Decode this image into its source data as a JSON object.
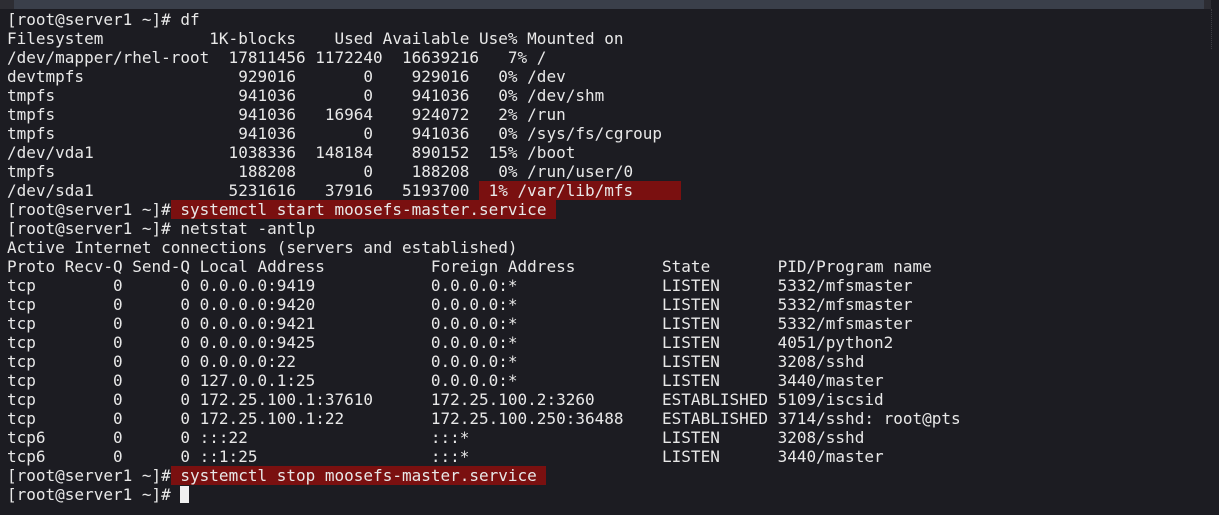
{
  "terminal": {
    "prompt": "[root@server1 ~]#",
    "lines": [
      {
        "t": "[root@server1 ~]# df"
      },
      {
        "t": "Filesystem           1K-blocks    Used Available Use% Mounted on"
      },
      {
        "t": "/dev/mapper/rhel-root  17811456 1172240  16639216   7% /"
      },
      {
        "t": "devtmpfs                929016       0    929016   0% /dev"
      },
      {
        "t": "tmpfs                   941036       0    941036   0% /dev/shm"
      },
      {
        "t": "tmpfs                   941036   16964    924072   2% /run"
      },
      {
        "t": "tmpfs                   941036       0    941036   0% /sys/fs/cgroup"
      },
      {
        "t": "/dev/vda1              1038336  148184    890152  15% /boot"
      },
      {
        "t": "tmpfs                   188208       0    188208   0% /run/user/0"
      },
      {
        "a": "/dev/sda1              5231616   37916   5193700 ",
        "h": " 1% /var/lib/mfs     "
      },
      {
        "a": "[root@server1 ~]#",
        "h": " systemctl start moosefs-master.service "
      },
      {
        "t": "[root@server1 ~]# netstat -antlp"
      },
      {
        "t": "Active Internet connections (servers and established)"
      },
      {
        "t": "Proto Recv-Q Send-Q Local Address           Foreign Address         State       PID/Program name"
      },
      {
        "t": "tcp        0      0 0.0.0.0:9419            0.0.0.0:*               LISTEN      5332/mfsmaster"
      },
      {
        "t": "tcp        0      0 0.0.0.0:9420            0.0.0.0:*               LISTEN      5332/mfsmaster"
      },
      {
        "t": "tcp        0      0 0.0.0.0:9421            0.0.0.0:*               LISTEN      5332/mfsmaster"
      },
      {
        "t": "tcp        0      0 0.0.0.0:9425            0.0.0.0:*               LISTEN      4051/python2"
      },
      {
        "t": "tcp        0      0 0.0.0.0:22              0.0.0.0:*               LISTEN      3208/sshd"
      },
      {
        "t": "tcp        0      0 127.0.0.1:25            0.0.0.0:*               LISTEN      3440/master"
      },
      {
        "t": "tcp        0      0 172.25.100.1:37610      172.25.100.2:3260       ESTABLISHED 5109/iscsid"
      },
      {
        "t": "tcp        0      0 172.25.100.1:22         172.25.100.250:36488    ESTABLISHED 3714/sshd: root@pts"
      },
      {
        "t": "tcp6       0      0 :::22                   :::*                    LISTEN      3208/sshd"
      },
      {
        "t": "tcp6       0      0 ::1:25                  :::*                    LISTEN      3440/master"
      },
      {
        "a": "[root@server1 ~]#",
        "h": " systemctl stop moosefs-master.service "
      },
      {
        "a": "[root@server1 ~]# ",
        "cursor": true
      }
    ]
  }
}
